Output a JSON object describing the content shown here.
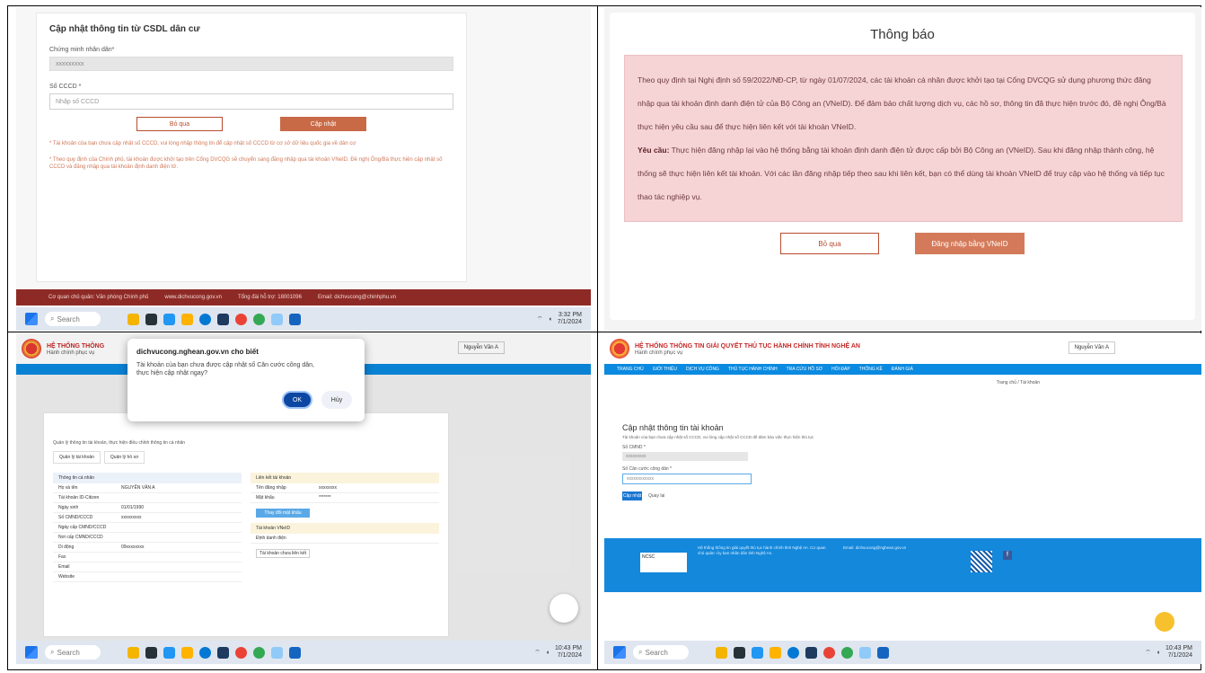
{
  "p1": {
    "title": "Cập nhật thông tin từ CSDL dân cư",
    "label_id": "Chứng minh nhân dân*",
    "id_value": "xxxxxxxxx",
    "label_cccd": "Số CCCD *",
    "cccd_placeholder": "Nhập số CCCD",
    "btn_skip": "Bỏ qua",
    "btn_update": "Cập nhật",
    "note1": "* Tài khoản của bạn chưa cập nhật số CCCD, vui lòng nhập thông tin để cập nhật số CCCD từ cơ sở dữ liệu quốc gia về dân cư",
    "note2": "* Theo quy định của Chính phủ, tài khoản được khởi tạo trên Cổng DVCQG sẽ chuyển sang đăng nhập qua tài khoản VNeID. Đề nghị Ông/Bà thực hiện cập nhật số CCCD và đăng nhập qua tài khoản định danh điện tử.",
    "footer": [
      "Cơ quan chủ quản: Văn phòng Chính phủ",
      "www.dichvucong.gov.vn",
      "Tổng đài hỗ trợ: 18001096",
      "Email: dichvucong@chinhphu.vn"
    ],
    "taskbar_time": "3:32 PM",
    "taskbar_date": "7/1/2024",
    "search_label": "Search"
  },
  "p2": {
    "title": "Thông báo",
    "para1": "Theo quy định tại Nghị định số 59/2022/NĐ-CP, từ ngày 01/07/2024, các tài khoản cá nhân được khởi tạo tại Cổng DVCQG sử dụng phương thức đăng nhập qua tài khoản định danh điện tử của Bộ Công an (VNeID). Để đảm bảo chất lượng dịch vụ, các hồ sơ, thông tin đã thực hiện trước đó, đề nghị Ông/Bà thực hiện yêu cầu sau để thực hiện liên kết với tài khoản VNeID.",
    "req_label": "Yêu cầu:",
    "para2": "Thực hiện đăng nhập lại vào hệ thống bằng tài khoản định danh điện tử được cấp bởi Bộ Công an (VNeID). Sau khi đăng nhập thành công, hệ thống sẽ thực hiện liên kết tài khoản. Với các lần đăng nhập tiếp theo sau khi liên kết, bạn có thể dùng tài khoản VNeID để truy cập vào hệ thống và tiếp tục thao tác nghiệp vụ.",
    "btn_skip": "Bỏ qua",
    "btn_login": "Đăng nhập bằng VNeID"
  },
  "p3": {
    "site_title": "HỆ THỐNG THÔNG",
    "site_sub": "Hành chính phục vụ",
    "user_btn": "Nguyễn Văn A",
    "dialog_title": "dichvucong.nghean.gov.vn cho biết",
    "dialog_msg": "Tài khoản của bạn chưa được cập nhật số Căn cước công dân, thực hiện cập nhật ngay?",
    "ok": "OK",
    "cancel": "Hủy",
    "section_note": "Quản lý thông tin tài khoản, thực hiện điều chỉnh thông tin cá nhân",
    "tabs": [
      "Quản lý tài khoản",
      "Quản lý hồ sơ"
    ],
    "left_header": "Thông tin cá nhân",
    "rows": [
      [
        "Họ và tên",
        "NGUYỄN VĂN A"
      ],
      [
        "Tài khoản ID-Citizen",
        ""
      ],
      [
        "Ngày sinh",
        "01/01/1990"
      ],
      [
        "Số CMND/CCCD",
        "xxxxxxxxx"
      ],
      [
        "Ngày cấp CMND/CCCD",
        ""
      ],
      [
        "Nơi cấp CMND/CCCD",
        ""
      ],
      [
        "Di động",
        "09xxxxxxxx"
      ],
      [
        "Fax",
        ""
      ],
      [
        "Email",
        ""
      ],
      [
        "Website",
        ""
      ]
    ],
    "right_header1": "Liên kết tài khoản",
    "r_rows": [
      [
        "Tên đăng nhập",
        "xxxxxxxx"
      ],
      [
        "Mật khẩu",
        "*******"
      ]
    ],
    "btn_change": "Thay đổi mật khẩu",
    "right_header2": "Tài khoản VNeID",
    "r_rows2": [
      [
        "Định danh điện",
        ""
      ]
    ],
    "btn_link": "Tài khoản chưa liên kết",
    "taskbar_time": "10:43 PM",
    "taskbar_date": "7/1/2024",
    "search_label": "Search"
  },
  "p4": {
    "site_title": "HỆ THỐNG THÔNG TIN GIẢI QUYẾT THỦ TỤC HÀNH CHÍNH TỈNH NGHỆ AN",
    "site_sub": "Hành chính phục vụ",
    "user_btn": "Nguyễn Văn A",
    "nav": [
      "TRANG CHỦ",
      "GIỚI THIỆU",
      "DỊCH VỤ CÔNG",
      "THỦ TỤC HÀNH CHÍNH",
      "TRA CỨU HỒ SƠ",
      "HỎI ĐÁP",
      "THỐNG KÊ",
      "ĐÁNH GIÁ"
    ],
    "crumb": [
      "Trang chủ",
      "Tài khoản"
    ],
    "title": "Cập nhật thông tin tài khoản",
    "subtitle": "Tài khoản của bạn chưa cập nhật số CCCD, vui lòng cập nhật số CCCD để đảm bảo việc thực hiện thủ tục",
    "label_id": "Số CMND *",
    "id_value": "xxxxxxxxx",
    "label_cccd": "Số Căn cước công dân *",
    "cccd_value": "xxxxxxxxxxxx",
    "btn_save": "Cập nhật",
    "btn_back": "Quay lại",
    "footer_text": "Hệ thống thông tin giải quyết thủ tục hành chính tỉnh Nghệ An. Cơ quan chủ quản: Ủy ban nhân dân tỉnh Nghệ An.",
    "footer_contact": "Email: dichvucong@nghean.gov.vn",
    "ncsc": "NCSC",
    "taskbar_time": "10:43 PM",
    "taskbar_date": "7/1/2024",
    "search_label": "Search"
  }
}
